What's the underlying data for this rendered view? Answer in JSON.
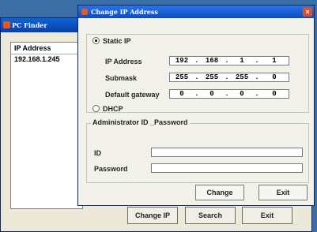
{
  "background_window": {
    "title": "PC Finder",
    "list_header": "IP Address",
    "list_rows": [
      "192.168.1.245"
    ],
    "buttons": {
      "change": "Change IP",
      "search": "Search",
      "exit": "Exit"
    }
  },
  "dialog": {
    "title": "Change IP Address",
    "close": "×",
    "static_ip_label": "Static IP",
    "ip_address_label": "IP Address",
    "ip_address": [
      "192",
      "168",
      "1",
      "1"
    ],
    "submask_label": "Submask",
    "submask": [
      "255",
      "255",
      "255",
      "0"
    ],
    "gateway_label": "Default gateway",
    "gateway": [
      "0",
      "0",
      "0",
      "0"
    ],
    "dhcp_label": "DHCP",
    "admin_group_label": "Administrator ID _Password",
    "id_label": "ID",
    "password_label": "Password",
    "change_button": "Change",
    "exit_button": "Exit"
  }
}
